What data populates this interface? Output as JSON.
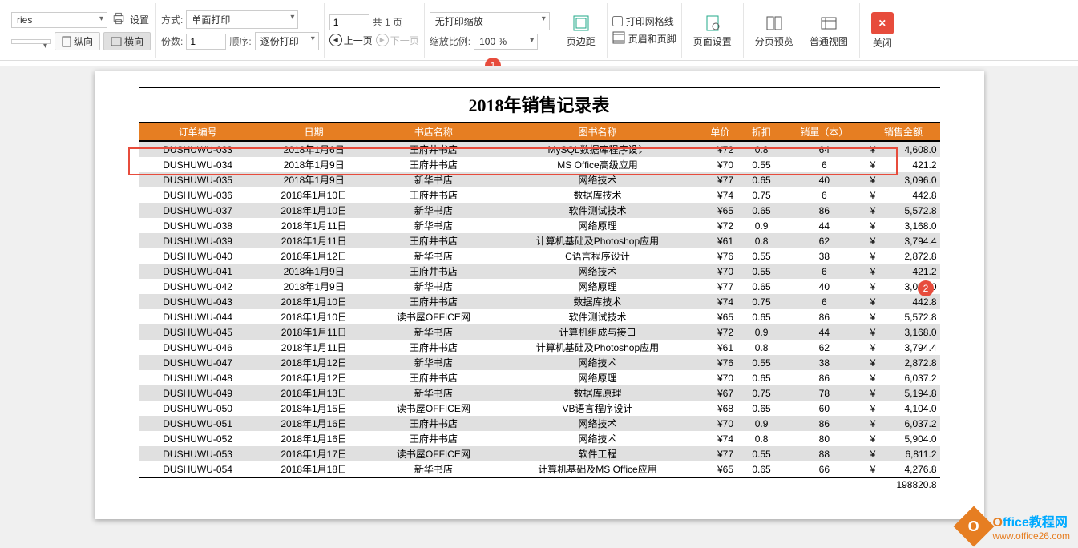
{
  "ribbon": {
    "printer_suffix": "ries",
    "settings": "设置",
    "mode_label": "方式:",
    "mode_value": "单面打印",
    "page_current": "1",
    "page_total_label": "共 1 页",
    "zoom_mode": "无打印缩放",
    "portrait": "纵向",
    "landscape": "横向",
    "copies_label": "份数:",
    "copies_value": "1",
    "order_label": "顺序:",
    "order_value": "逐份打印",
    "prev_page": "上一页",
    "next_page": "下一页",
    "zoom_ratio_label": "缩放比例:",
    "zoom_ratio_value": "100 %",
    "margins": "页边距",
    "gridlines": "打印网格线",
    "header_footer": "页眉和页脚",
    "page_setup": "页面设置",
    "pagebreak_preview": "分页预览",
    "normal_view": "普通视图",
    "close": "关闭"
  },
  "callouts": {
    "c1": "1",
    "c2": "2"
  },
  "sheet": {
    "title": "2018年销售记录表",
    "headers": [
      "订单编号",
      "日期",
      "书店名称",
      "图书名称",
      "单价",
      "折扣",
      "销量（本）",
      "销售金额"
    ],
    "total": "198820.8",
    "rows": [
      {
        "id": "DUSHUWU-033",
        "date": "2018年1月6日",
        "store": "王府井书店",
        "book": "MySQL数据库程序设计",
        "price": "¥72",
        "disc": "0.8",
        "qty": "64",
        "amt": "4,608.0"
      },
      {
        "id": "DUSHUWU-034",
        "date": "2018年1月9日",
        "store": "王府井书店",
        "book": "MS Office高级应用",
        "price": "¥70",
        "disc": "0.55",
        "qty": "6",
        "amt": "421.2"
      },
      {
        "id": "DUSHUWU-035",
        "date": "2018年1月9日",
        "store": "新华书店",
        "book": "网络技术",
        "price": "¥77",
        "disc": "0.65",
        "qty": "40",
        "amt": "3,096.0"
      },
      {
        "id": "DUSHUWU-036",
        "date": "2018年1月10日",
        "store": "王府井书店",
        "book": "数据库技术",
        "price": "¥74",
        "disc": "0.75",
        "qty": "6",
        "amt": "442.8"
      },
      {
        "id": "DUSHUWU-037",
        "date": "2018年1月10日",
        "store": "新华书店",
        "book": "软件测试技术",
        "price": "¥65",
        "disc": "0.65",
        "qty": "86",
        "amt": "5,572.8"
      },
      {
        "id": "DUSHUWU-038",
        "date": "2018年1月11日",
        "store": "新华书店",
        "book": "网络原理",
        "price": "¥72",
        "disc": "0.9",
        "qty": "44",
        "amt": "3,168.0"
      },
      {
        "id": "DUSHUWU-039",
        "date": "2018年1月11日",
        "store": "王府井书店",
        "book": "计算机基础及Photoshop应用",
        "price": "¥61",
        "disc": "0.8",
        "qty": "62",
        "amt": "3,794.4"
      },
      {
        "id": "DUSHUWU-040",
        "date": "2018年1月12日",
        "store": "新华书店",
        "book": "C语言程序设计",
        "price": "¥76",
        "disc": "0.55",
        "qty": "38",
        "amt": "2,872.8"
      },
      {
        "id": "DUSHUWU-041",
        "date": "2018年1月9日",
        "store": "王府井书店",
        "book": "网络技术",
        "price": "¥70",
        "disc": "0.55",
        "qty": "6",
        "amt": "421.2"
      },
      {
        "id": "DUSHUWU-042",
        "date": "2018年1月9日",
        "store": "新华书店",
        "book": "网络原理",
        "price": "¥77",
        "disc": "0.65",
        "qty": "40",
        "amt": "3,096.0"
      },
      {
        "id": "DUSHUWU-043",
        "date": "2018年1月10日",
        "store": "王府井书店",
        "book": "数据库技术",
        "price": "¥74",
        "disc": "0.75",
        "qty": "6",
        "amt": "442.8"
      },
      {
        "id": "DUSHUWU-044",
        "date": "2018年1月10日",
        "store": "读书屋OFFICE网",
        "book": "软件测试技术",
        "price": "¥65",
        "disc": "0.65",
        "qty": "86",
        "amt": "5,572.8"
      },
      {
        "id": "DUSHUWU-045",
        "date": "2018年1月11日",
        "store": "新华书店",
        "book": "计算机组成与接口",
        "price": "¥72",
        "disc": "0.9",
        "qty": "44",
        "amt": "3,168.0"
      },
      {
        "id": "DUSHUWU-046",
        "date": "2018年1月11日",
        "store": "王府井书店",
        "book": "计算机基础及Photoshop应用",
        "price": "¥61",
        "disc": "0.8",
        "qty": "62",
        "amt": "3,794.4"
      },
      {
        "id": "DUSHUWU-047",
        "date": "2018年1月12日",
        "store": "新华书店",
        "book": "网络技术",
        "price": "¥76",
        "disc": "0.55",
        "qty": "38",
        "amt": "2,872.8"
      },
      {
        "id": "DUSHUWU-048",
        "date": "2018年1月12日",
        "store": "王府井书店",
        "book": "网络原理",
        "price": "¥70",
        "disc": "0.65",
        "qty": "86",
        "amt": "6,037.2"
      },
      {
        "id": "DUSHUWU-049",
        "date": "2018年1月13日",
        "store": "新华书店",
        "book": "数据库原理",
        "price": "¥67",
        "disc": "0.75",
        "qty": "78",
        "amt": "5,194.8"
      },
      {
        "id": "DUSHUWU-050",
        "date": "2018年1月15日",
        "store": "读书屋OFFICE网",
        "book": "VB语言程序设计",
        "price": "¥68",
        "disc": "0.65",
        "qty": "60",
        "amt": "4,104.0"
      },
      {
        "id": "DUSHUWU-051",
        "date": "2018年1月16日",
        "store": "王府井书店",
        "book": "网络技术",
        "price": "¥70",
        "disc": "0.9",
        "qty": "86",
        "amt": "6,037.2"
      },
      {
        "id": "DUSHUWU-052",
        "date": "2018年1月16日",
        "store": "王府井书店",
        "book": "网络技术",
        "price": "¥74",
        "disc": "0.8",
        "qty": "80",
        "amt": "5,904.0"
      },
      {
        "id": "DUSHUWU-053",
        "date": "2018年1月17日",
        "store": "读书屋OFFICE网",
        "book": "软件工程",
        "price": "¥77",
        "disc": "0.55",
        "qty": "88",
        "amt": "6,811.2"
      },
      {
        "id": "DUSHUWU-054",
        "date": "2018年1月18日",
        "store": "新华书店",
        "book": "计算机基础及MS Office应用",
        "price": "¥65",
        "disc": "0.65",
        "qty": "66",
        "amt": "4,276.8"
      }
    ]
  },
  "currency": "¥",
  "watermark": {
    "icon_letter": "O",
    "line1": "ffice教程网",
    "line2": "www.office26.com"
  }
}
